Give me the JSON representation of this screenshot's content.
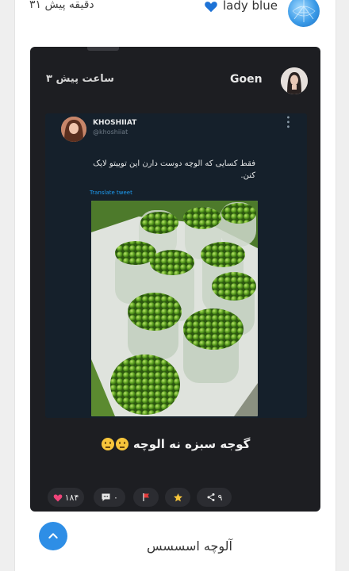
{
  "header": {
    "username": "lady blue",
    "time": "۳۱ دقیقه پیش"
  },
  "post": {
    "username": "Goen",
    "time": "۳ ساعت پیش",
    "tweet": {
      "name": "KHOSHIIAT",
      "handle": "@khoshiiat",
      "text": "فقط کسایی که الوچه دوست دارن این توییتو لایک کنن.",
      "translate_label": "Translate tweet"
    },
    "caption": "گوجه سبزه نه الوچه",
    "actions": {
      "likes": "۱۸۴",
      "comments": "۰",
      "shares": "۹"
    }
  },
  "next_post": {
    "title": "آلوچه اسسسس"
  },
  "colors": {
    "accent": "#2e8ee6",
    "post_bg": "#1d1e22",
    "tweet_bg": "#15202b"
  }
}
